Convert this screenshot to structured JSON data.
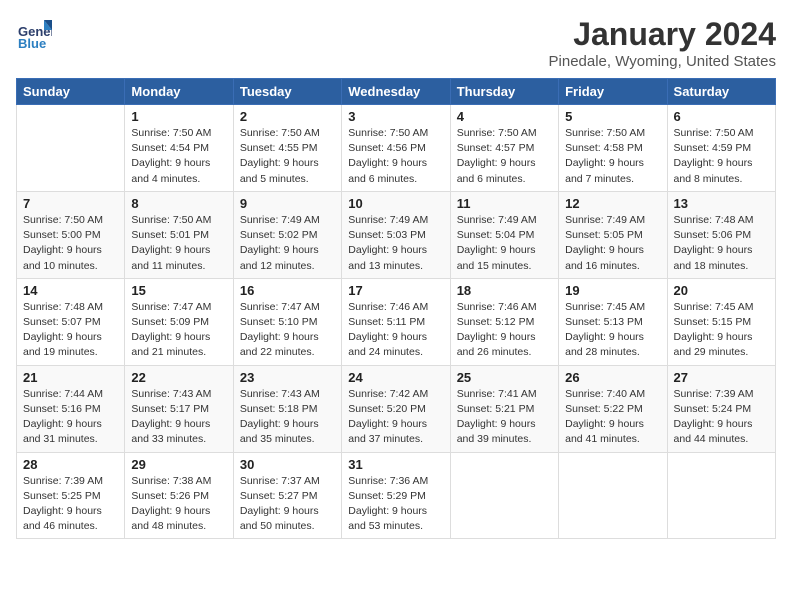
{
  "logo": {
    "text_general": "General",
    "text_blue": "Blue"
  },
  "header": {
    "month": "January 2024",
    "location": "Pinedale, Wyoming, United States"
  },
  "weekdays": [
    "Sunday",
    "Monday",
    "Tuesday",
    "Wednesday",
    "Thursday",
    "Friday",
    "Saturday"
  ],
  "weeks": [
    [
      {
        "day": "",
        "empty": true
      },
      {
        "day": "1",
        "sunrise": "7:50 AM",
        "sunset": "4:54 PM",
        "daylight": "9 hours and 4 minutes."
      },
      {
        "day": "2",
        "sunrise": "7:50 AM",
        "sunset": "4:55 PM",
        "daylight": "9 hours and 5 minutes."
      },
      {
        "day": "3",
        "sunrise": "7:50 AM",
        "sunset": "4:56 PM",
        "daylight": "9 hours and 6 minutes."
      },
      {
        "day": "4",
        "sunrise": "7:50 AM",
        "sunset": "4:57 PM",
        "daylight": "9 hours and 6 minutes."
      },
      {
        "day": "5",
        "sunrise": "7:50 AM",
        "sunset": "4:58 PM",
        "daylight": "9 hours and 7 minutes."
      },
      {
        "day": "6",
        "sunrise": "7:50 AM",
        "sunset": "4:59 PM",
        "daylight": "9 hours and 8 minutes."
      }
    ],
    [
      {
        "day": "7",
        "sunrise": "7:50 AM",
        "sunset": "5:00 PM",
        "daylight": "9 hours and 10 minutes."
      },
      {
        "day": "8",
        "sunrise": "7:50 AM",
        "sunset": "5:01 PM",
        "daylight": "9 hours and 11 minutes."
      },
      {
        "day": "9",
        "sunrise": "7:49 AM",
        "sunset": "5:02 PM",
        "daylight": "9 hours and 12 minutes."
      },
      {
        "day": "10",
        "sunrise": "7:49 AM",
        "sunset": "5:03 PM",
        "daylight": "9 hours and 13 minutes."
      },
      {
        "day": "11",
        "sunrise": "7:49 AM",
        "sunset": "5:04 PM",
        "daylight": "9 hours and 15 minutes."
      },
      {
        "day": "12",
        "sunrise": "7:49 AM",
        "sunset": "5:05 PM",
        "daylight": "9 hours and 16 minutes."
      },
      {
        "day": "13",
        "sunrise": "7:48 AM",
        "sunset": "5:06 PM",
        "daylight": "9 hours and 18 minutes."
      }
    ],
    [
      {
        "day": "14",
        "sunrise": "7:48 AM",
        "sunset": "5:07 PM",
        "daylight": "9 hours and 19 minutes."
      },
      {
        "day": "15",
        "sunrise": "7:47 AM",
        "sunset": "5:09 PM",
        "daylight": "9 hours and 21 minutes."
      },
      {
        "day": "16",
        "sunrise": "7:47 AM",
        "sunset": "5:10 PM",
        "daylight": "9 hours and 22 minutes."
      },
      {
        "day": "17",
        "sunrise": "7:46 AM",
        "sunset": "5:11 PM",
        "daylight": "9 hours and 24 minutes."
      },
      {
        "day": "18",
        "sunrise": "7:46 AM",
        "sunset": "5:12 PM",
        "daylight": "9 hours and 26 minutes."
      },
      {
        "day": "19",
        "sunrise": "7:45 AM",
        "sunset": "5:13 PM",
        "daylight": "9 hours and 28 minutes."
      },
      {
        "day": "20",
        "sunrise": "7:45 AM",
        "sunset": "5:15 PM",
        "daylight": "9 hours and 29 minutes."
      }
    ],
    [
      {
        "day": "21",
        "sunrise": "7:44 AM",
        "sunset": "5:16 PM",
        "daylight": "9 hours and 31 minutes."
      },
      {
        "day": "22",
        "sunrise": "7:43 AM",
        "sunset": "5:17 PM",
        "daylight": "9 hours and 33 minutes."
      },
      {
        "day": "23",
        "sunrise": "7:43 AM",
        "sunset": "5:18 PM",
        "daylight": "9 hours and 35 minutes."
      },
      {
        "day": "24",
        "sunrise": "7:42 AM",
        "sunset": "5:20 PM",
        "daylight": "9 hours and 37 minutes."
      },
      {
        "day": "25",
        "sunrise": "7:41 AM",
        "sunset": "5:21 PM",
        "daylight": "9 hours and 39 minutes."
      },
      {
        "day": "26",
        "sunrise": "7:40 AM",
        "sunset": "5:22 PM",
        "daylight": "9 hours and 41 minutes."
      },
      {
        "day": "27",
        "sunrise": "7:39 AM",
        "sunset": "5:24 PM",
        "daylight": "9 hours and 44 minutes."
      }
    ],
    [
      {
        "day": "28",
        "sunrise": "7:39 AM",
        "sunset": "5:25 PM",
        "daylight": "9 hours and 46 minutes."
      },
      {
        "day": "29",
        "sunrise": "7:38 AM",
        "sunset": "5:26 PM",
        "daylight": "9 hours and 48 minutes."
      },
      {
        "day": "30",
        "sunrise": "7:37 AM",
        "sunset": "5:27 PM",
        "daylight": "9 hours and 50 minutes."
      },
      {
        "day": "31",
        "sunrise": "7:36 AM",
        "sunset": "5:29 PM",
        "daylight": "9 hours and 53 minutes."
      },
      {
        "day": "",
        "empty": true
      },
      {
        "day": "",
        "empty": true
      },
      {
        "day": "",
        "empty": true
      }
    ]
  ]
}
